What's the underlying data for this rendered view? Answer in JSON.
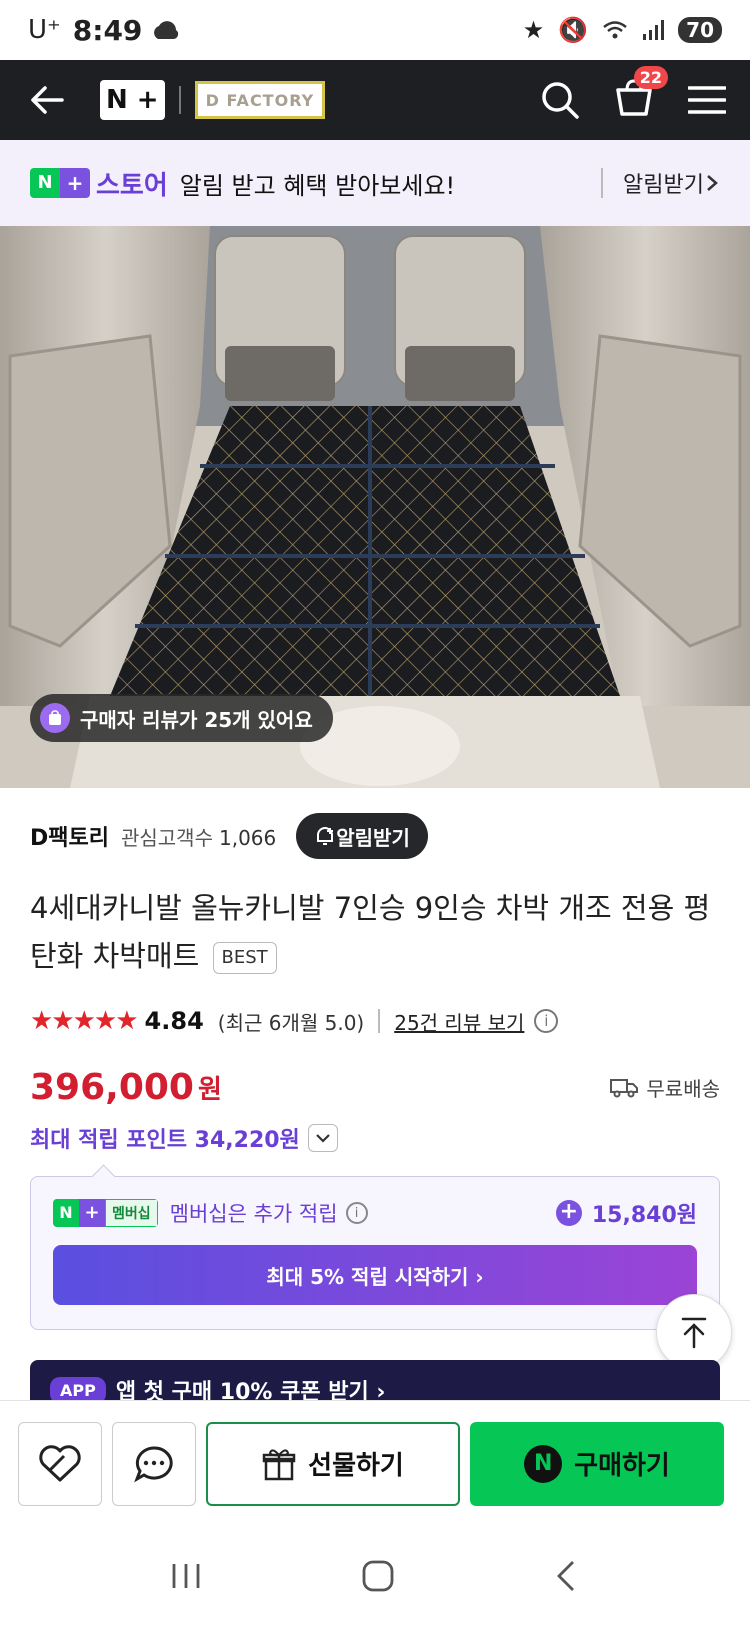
{
  "status": {
    "carrier": "U⁺",
    "time": "8:49",
    "battery": "70"
  },
  "header": {
    "brand": "N +",
    "store_logo": "D FACTORY",
    "cart_count": "22"
  },
  "banner": {
    "badge_n": "N",
    "badge_plus": "+",
    "store_label": "스토어",
    "message": "알림 받고 혜택 받아보세요!",
    "link": "알림받기"
  },
  "hero": {
    "review_pill": "구매자 리뷰가 25개 있어요"
  },
  "seller": {
    "name": "D팩토리",
    "fans_label": "관심고객수",
    "fans_count": "1,066",
    "alarm_button": "알림받기"
  },
  "product": {
    "title": "4세대카니발 올뉴카니발 7인승 9인승 차박 개조 전용 평탄화 차박매트",
    "badge": "BEST",
    "rating": "4.84",
    "recent_rating": "(최근 6개월 5.0)",
    "review_link": "25건 리뷰 보기",
    "price": "396,000",
    "currency": "원",
    "shipping": "무료배송",
    "points": "최대 적립 포인트 34,220원"
  },
  "membership": {
    "badge_label": "멤버십",
    "text": "멤버십은 추가 적립",
    "points": "15,840원",
    "cta": "최대 5% 적립 시작하기 ›"
  },
  "app_coupon": {
    "tag": "APP",
    "text": "앱 첫 구매 10% 쿠폰 받기 ›"
  },
  "actions": {
    "gift": "선물하기",
    "buy": "구매하기",
    "buy_icon": "N"
  }
}
